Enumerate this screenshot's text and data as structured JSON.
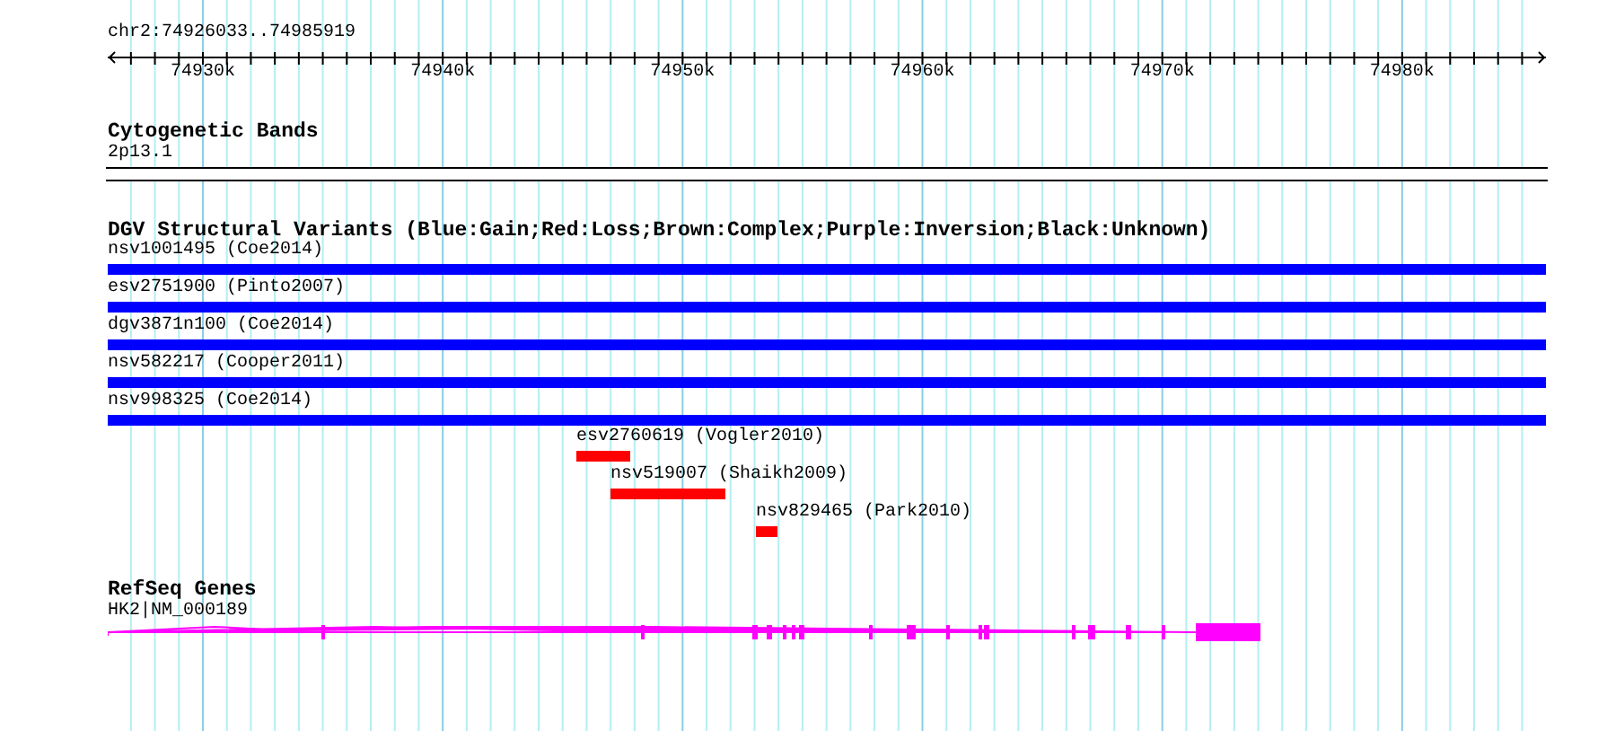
{
  "ruler": {
    "title": "chr2:74926033..74985919",
    "tick_labels": [
      "74930k",
      "74940k",
      "74950k",
      "74960k",
      "74970k",
      "74980k"
    ]
  },
  "cytogenetic_bands": {
    "title": "Cytogenetic Bands",
    "band": "2p13.1"
  },
  "dgv_variants": {
    "title": "DGV Structural Variants (Blue:Gain;Red:Loss;Brown:Complex;Purple:Inversion;Black:Unknown)",
    "items": [
      {
        "label": "nsv1001495 (Coe2014)",
        "color": "#0000ff"
      },
      {
        "label": "esv2751900 (Pinto2007)",
        "color": "#0000ff"
      },
      {
        "label": "dgv3871n100 (Coe2014)",
        "color": "#0000ff"
      },
      {
        "label": "nsv582217 (Cooper2011)",
        "color": "#0000ff"
      },
      {
        "label": "nsv998325 (Coe2014)",
        "color": "#0000ff"
      },
      {
        "label": "esv2760619 (Vogler2010)",
        "color": "#ff0000"
      },
      {
        "label": "nsv519007 (Shaikh2009)",
        "color": "#ff0000"
      },
      {
        "label": "nsv829465 (Park2010)",
        "color": "#ff0000"
      }
    ]
  },
  "refseq_genes": {
    "title": "RefSeq Genes",
    "genes": [
      {
        "label": "HK2|NM_000189"
      }
    ]
  }
}
